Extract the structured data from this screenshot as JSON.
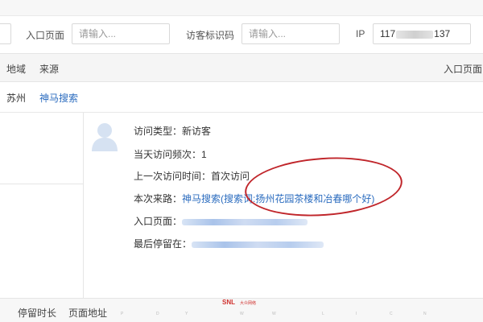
{
  "filters": {
    "entry_page_label": "入口页面",
    "entry_page_placeholder": "请输入...",
    "visitor_id_label": "访客标识码",
    "visitor_id_placeholder": "请输入...",
    "ip_label": "IP",
    "ip_prefix": "117",
    "ip_suffix": "137"
  },
  "table": {
    "columns": [
      "地域",
      "来源",
      "入口页面"
    ]
  },
  "row": {
    "region": "苏州",
    "source": "神马搜索"
  },
  "detail": {
    "visit_type_label": "访问类型：",
    "visit_type_value": "新访客",
    "frequency_label": "当天访问频次：",
    "frequency_value": "1",
    "last_visit_label": "上一次访问时间：",
    "last_visit_value": "首次访问",
    "source_label": "本次来路：",
    "source_value": "神马搜索(搜索词:扬州花园茶楼和冶春哪个好)",
    "entry_label": "入口页面：",
    "last_stay_label": "最后停留在："
  },
  "bottom": {
    "stay_duration": "停留时长",
    "page_address": "页面地址"
  },
  "watermark": {
    "brand": "SNL",
    "sub": "大众网络",
    "letters": [
      "P",
      "D",
      "Y",
      "W",
      "W",
      "L",
      "I",
      "C",
      "N"
    ]
  },
  "colors": {
    "link": "#2b6cbf",
    "annotation": "#c0262b",
    "header_bg": "#f5f5f5"
  }
}
